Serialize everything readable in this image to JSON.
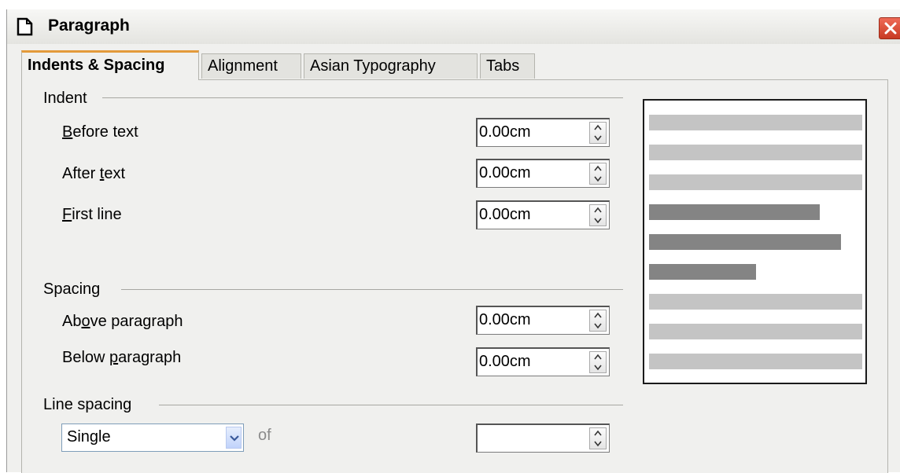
{
  "window": {
    "title": "Paragraph"
  },
  "tabs": [
    {
      "label": "Indents & Spacing",
      "active": true
    },
    {
      "label": "Alignment",
      "active": false
    },
    {
      "label": "Asian Typography",
      "active": false
    },
    {
      "label": "Tabs",
      "active": false
    }
  ],
  "indent": {
    "section_label": "Indent",
    "before_text": {
      "label_mnemonic": "B",
      "label_rest": "efore text",
      "value": "0.00cm"
    },
    "after_text": {
      "label_pre": "After ",
      "label_mnemonic": "t",
      "label_rest": "ext",
      "value": "0.00cm"
    },
    "first_line": {
      "label_mnemonic": "F",
      "label_rest": "irst line",
      "value": "0.00cm"
    }
  },
  "spacing": {
    "section_label": "Spacing",
    "above_paragraph": {
      "label_pre": "Ab",
      "label_mnemonic": "o",
      "label_rest": "ve paragraph",
      "value": "0.00cm"
    },
    "below_paragraph": {
      "label_pre": "Below ",
      "label_mnemonic": "p",
      "label_rest": "aragraph",
      "value": "0.00cm"
    }
  },
  "line_spacing": {
    "section_label": "Line spacing",
    "selected": "Single",
    "of_label": "of",
    "value": ""
  },
  "preview": {
    "colors": {
      "light": "#c4c4c4",
      "dark": "#848484"
    },
    "lines": [
      {
        "shade": "light",
        "length_fraction": 1.0
      },
      {
        "shade": "light",
        "length_fraction": 1.0
      },
      {
        "shade": "light",
        "length_fraction": 1.0
      },
      {
        "shade": "dark",
        "length_fraction": 0.8
      },
      {
        "shade": "dark",
        "length_fraction": 0.9
      },
      {
        "shade": "dark",
        "length_fraction": 0.5
      },
      {
        "shade": "light",
        "length_fraction": 1.0
      },
      {
        "shade": "light",
        "length_fraction": 1.0
      },
      {
        "shade": "light",
        "length_fraction": 1.0
      }
    ]
  },
  "icons": {
    "window": "document-page-icon",
    "close": "close-x-icon",
    "spin": "spin-up-down-icon",
    "dropdown": "chevron-down-icon"
  },
  "colors": {
    "active_tab_accent": "#e39a3b",
    "close_button": "#d5412a",
    "dialog_bg": "#f0f0ee"
  }
}
